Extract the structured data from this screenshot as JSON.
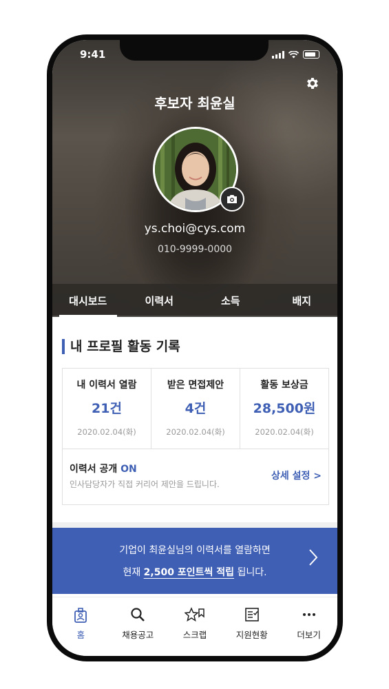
{
  "status_bar": {
    "time": "9:41"
  },
  "header": {
    "title": "후보자 최윤실",
    "settings_icon": "gear-icon"
  },
  "profile": {
    "email": "ys.choi@cys.com",
    "phone": "010-9999-0000",
    "camera_icon": "camera-icon"
  },
  "tabs": [
    {
      "label": "대시보드",
      "active": true
    },
    {
      "label": "이력서",
      "active": false
    },
    {
      "label": "소득",
      "active": false
    },
    {
      "label": "배지",
      "active": false
    }
  ],
  "section": {
    "title": "내 프로필 활동 기록"
  },
  "stats": [
    {
      "label": "내 이력서 열람",
      "value": "21건",
      "date": "2020.02.04(화)"
    },
    {
      "label": "받은 면접제안",
      "value": "4건",
      "date": "2020.02.04(화)"
    },
    {
      "label": "활동 보상금",
      "value": "28,500원",
      "date": "2020.02.04(화)"
    }
  ],
  "resume_open": {
    "title": "이력서 공개",
    "status": "ON",
    "description": "인사담당자가 직접 커리어 제안을 드립니다.",
    "detail_label": "상세 설정 >"
  },
  "banner": {
    "line1": "기업이 최윤실님의 이력서를 열람하면",
    "line2_prefix": "현재",
    "line2_bold": "2,500 포인트씩 적립",
    "line2_suffix": "됩니다."
  },
  "nav": [
    {
      "label": "홈",
      "icon": "home-badge-icon",
      "active": true
    },
    {
      "label": "채용공고",
      "icon": "search-icon",
      "active": false
    },
    {
      "label": "스크랩",
      "icon": "star-bookmark-icon",
      "active": false
    },
    {
      "label": "지원현황",
      "icon": "checklist-icon",
      "active": false
    },
    {
      "label": "더보기",
      "icon": "more-icon",
      "active": false
    }
  ],
  "colors": {
    "accent": "#3e5fb4",
    "banner": "#3f5fb5"
  }
}
